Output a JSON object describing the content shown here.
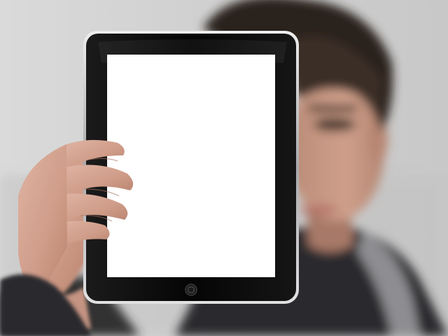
{
  "scene": {
    "description_tags": [
      "person",
      "tablet",
      "hand",
      "blank-screen"
    ],
    "colors": {
      "background": "#d0d0d0",
      "hair": "#2a211c",
      "skin": "#c79a86",
      "jacket_dark": "#2c2c2e",
      "jacket_light": "#8e8e92",
      "tablet_bezel": "#0b0b0b",
      "tablet_frame": "#c9c9cc",
      "screen": "#ffffff"
    }
  }
}
